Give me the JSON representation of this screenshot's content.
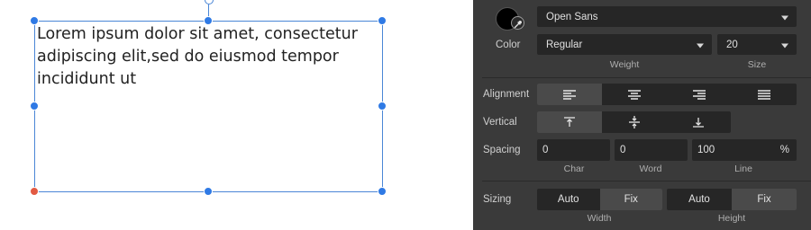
{
  "canvas": {
    "text": "Lorem ipsum dolor sit amet, consectetur adipiscing elit,sed do eiusmod tempor incididunt ut"
  },
  "panel": {
    "color": {
      "label": "Color",
      "swatch": "#000000",
      "eyedropper_icon": "eyedropper-icon"
    },
    "font": {
      "family": "Open Sans",
      "weight": "Regular",
      "size": "20",
      "weight_caption": "Weight",
      "size_caption": "Size"
    },
    "alignment": {
      "label": "Alignment",
      "options": [
        "align-left-icon",
        "align-center-icon",
        "align-right-icon",
        "align-justify-icon"
      ],
      "selected": "align-left-icon"
    },
    "vertical": {
      "label": "Vertical",
      "options": [
        "valign-top-icon",
        "valign-middle-icon",
        "valign-bottom-icon"
      ],
      "selected": "valign-top-icon"
    },
    "spacing": {
      "label": "Spacing",
      "char": "0",
      "word": "0",
      "line": "100",
      "line_unit": "%",
      "char_caption": "Char",
      "word_caption": "Word",
      "line_caption": "Line"
    },
    "sizing": {
      "label": "Sizing",
      "width_options": [
        "Auto",
        "Fix"
      ],
      "width_selected": "Fix",
      "height_options": [
        "Auto",
        "Fix"
      ],
      "height_selected": "Fix",
      "width_caption": "Width",
      "height_caption": "Height"
    }
  }
}
